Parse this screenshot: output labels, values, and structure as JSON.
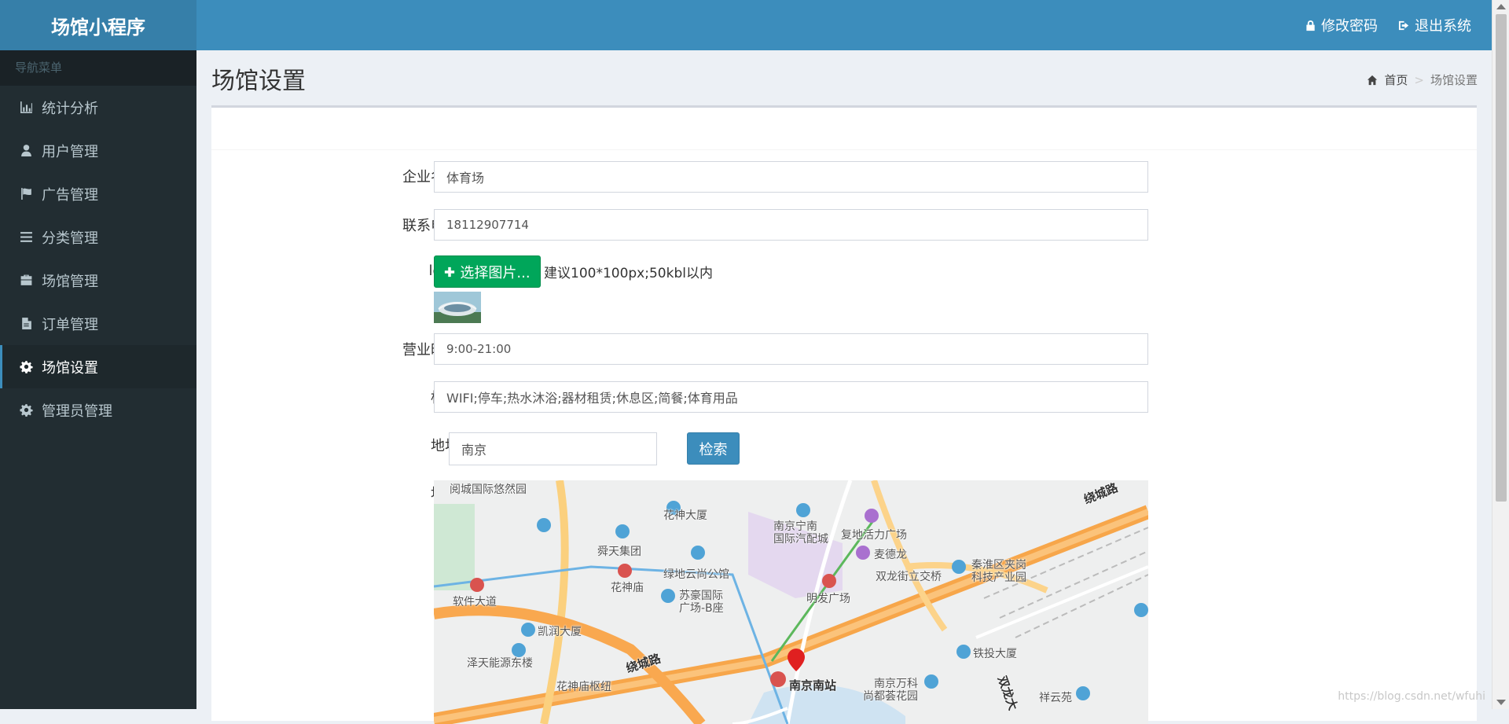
{
  "app": {
    "title": "场馆小程序"
  },
  "header": {
    "change_password": "修改密码",
    "logout": "退出系统"
  },
  "sidebar": {
    "header": "导航菜单",
    "items": [
      {
        "label": "统计分析",
        "icon": "bar-chart-icon",
        "active": false
      },
      {
        "label": "用户管理",
        "icon": "user-icon",
        "active": false
      },
      {
        "label": "广告管理",
        "icon": "flag-icon",
        "active": false
      },
      {
        "label": "分类管理",
        "icon": "list-icon",
        "active": false
      },
      {
        "label": "场馆管理",
        "icon": "briefcase-icon",
        "active": false
      },
      {
        "label": "订单管理",
        "icon": "file-icon",
        "active": false
      },
      {
        "label": "场馆设置",
        "icon": "gear-icon",
        "active": true
      },
      {
        "label": "管理员管理",
        "icon": "gear-icon",
        "active": false
      }
    ]
  },
  "page": {
    "title": "场馆设置"
  },
  "breadcrumb": {
    "home": "首页",
    "current": "场馆设置"
  },
  "form": {
    "company_name": {
      "label": "企业名称",
      "value": "体育场"
    },
    "phone": {
      "label": "联系电话",
      "value": "18112907714"
    },
    "logo": {
      "label": "logo",
      "button": "选择图片...",
      "hint": "建议100*100px;50kbl以内"
    },
    "hours": {
      "label": "营业时间",
      "value": "9:00-21:00"
    },
    "tags": {
      "label": "标签",
      "value": "WIFI;停车;热水沐浴;器材租赁;休息区;简餐;体育用品"
    },
    "address": {
      "label": "地址",
      "value": "南京",
      "button": "检索"
    },
    "map": {
      "label": "地图",
      "places": [
        "阅城国际悠然园",
        "花神大厦",
        "南京宁南",
        "国际汽配城",
        "复地活力广场",
        "麦德龙",
        "秦淮区夹岗",
        "科技产业园",
        "舜天集团",
        "花神庙",
        "绿地云尚公馆",
        "苏豪国际",
        "广场-B座",
        "明发广场",
        "双龙街立交桥",
        "软件大道",
        "凯润大厦",
        "泽天能源东楼",
        "花神庙枢纽",
        "绕城路",
        "南京南站",
        "南京万科",
        "尚都荟花园",
        "铁投大厦",
        "祥云苑",
        "绕城路",
        "双龙大"
      ]
    }
  },
  "watermark": "https://blog.csdn.net/wfuhi"
}
